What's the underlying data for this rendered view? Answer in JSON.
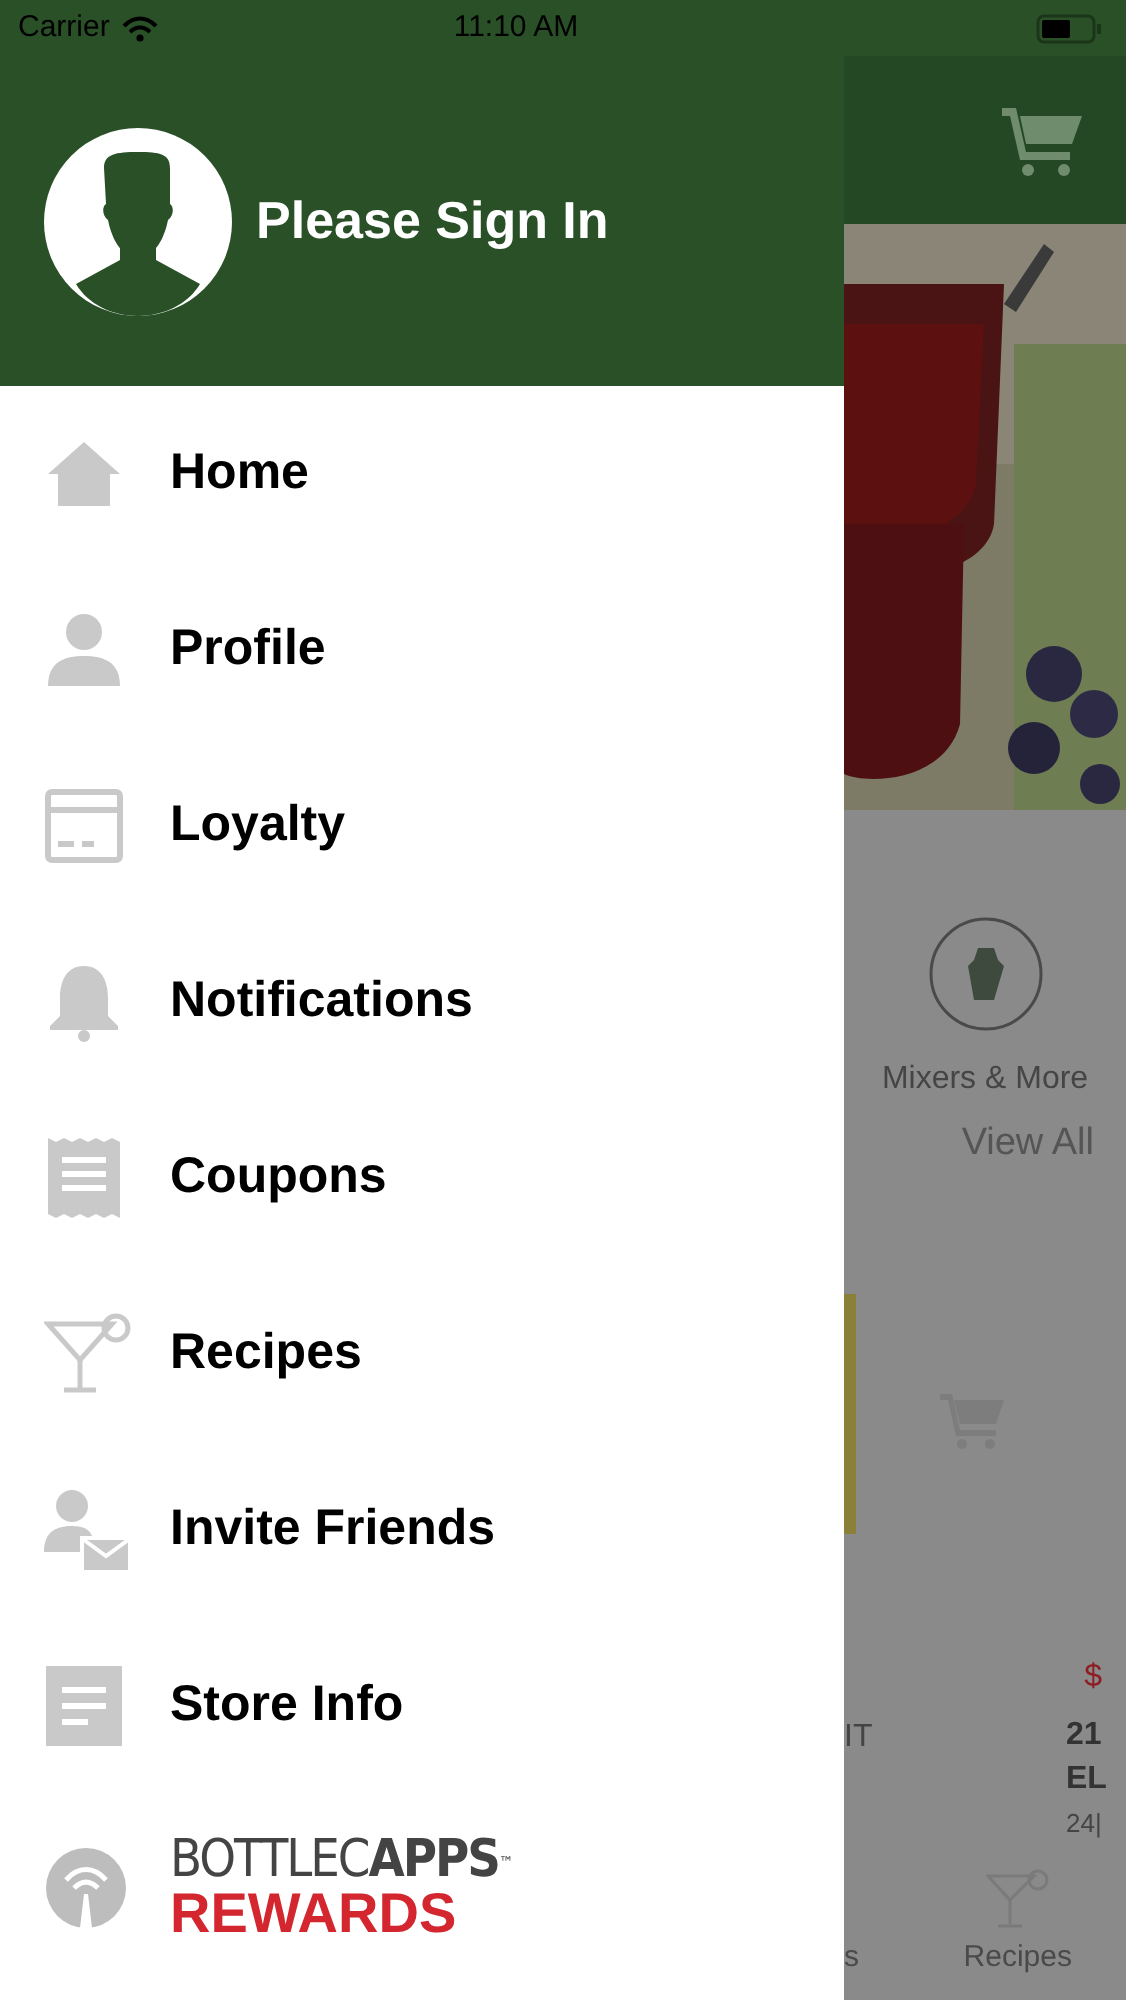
{
  "status_bar": {
    "carrier": "Carrier",
    "time": "11:10 AM"
  },
  "drawer": {
    "header": {
      "title": "Please Sign In"
    },
    "items": [
      {
        "label": "Home"
      },
      {
        "label": "Profile"
      },
      {
        "label": "Loyalty"
      },
      {
        "label": "Notifications"
      },
      {
        "label": "Coupons"
      },
      {
        "label": "Recipes"
      },
      {
        "label": "Invite Friends"
      },
      {
        "label": "Store Info"
      }
    ],
    "footer_logo": {
      "line_1": "BOTTLEC**APPS**$^{™}$",
      "line_2": "REWARDS"
    }
  },
  "background_app": {
    "category": "Mixers & More",
    "view_all": "View All",
    "price": "$",
    "product_1": "IT",
    "product_2_lines": [
      "21",
      "EL"
    ],
    "product_2_size": "24|",
    "tabs": [
      "s",
      "Recipes"
    ]
  }
}
